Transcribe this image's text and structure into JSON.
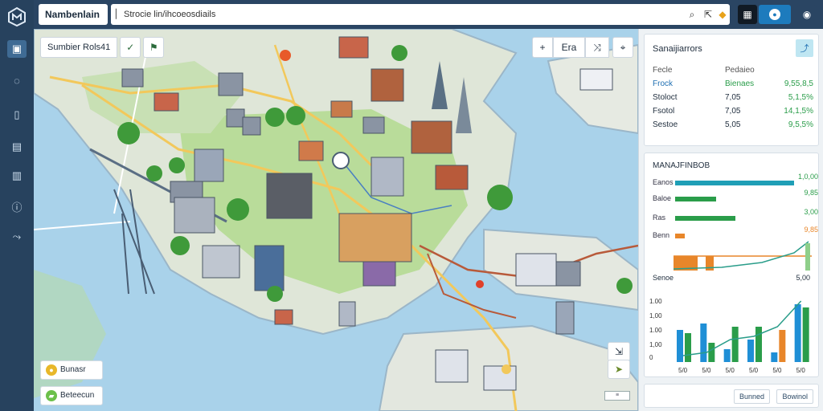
{
  "app": {
    "title": "Nambenlain"
  },
  "search": {
    "value": "Strocie lin/ihcoeosdiails"
  },
  "layer_bar": {
    "label": "Sumbier Rols41"
  },
  "map_controls": {
    "zoom_in": "+",
    "layers_label": "Era"
  },
  "legend": [
    {
      "label": "Bunasr",
      "color": "#e8b72a"
    },
    {
      "label": "Beteecun",
      "color": "#6cc04a"
    }
  ],
  "panel": {
    "summary": {
      "title": "Sanaijiarrors",
      "col1": "Fecle",
      "col2": "Pedaieo",
      "rows": [
        {
          "name": "Frock",
          "v1": "Bienaes",
          "v2": "9,55,8,5"
        },
        {
          "name": "Stoloct",
          "v1": "7,05",
          "v2": "5,1,5%"
        },
        {
          "name": "Fsotol",
          "v1": "7,05",
          "v2": "14,1,5%"
        },
        {
          "name": "Sestoe",
          "v1": "5,05",
          "v2": "9,5,5%"
        }
      ]
    },
    "metrics": {
      "title": "MANAJFINBOB",
      "rows": [
        {
          "name": "Eanos",
          "value": "1,0,00",
          "fraction": 0.95,
          "color": "#1f9fb6"
        },
        {
          "name": "Baloe",
          "value": "9,85",
          "fraction": 0.33,
          "color": "#2a9d4a"
        },
        {
          "name": "Ras",
          "value": "3,00",
          "fraction": 0.48,
          "color": "#2a9d4a"
        },
        {
          "name": "Benn",
          "value": "9,85",
          "fraction": 0.08,
          "color": "#e8862a"
        }
      ],
      "trend_label": "Senoe",
      "mini_end": "5,00",
      "bottom_chart": {
        "y_ticks": [
          "1.00",
          "1,00",
          "1.00",
          "1,00",
          "0"
        ],
        "x_ticks": [
          "5/0",
          "5/0",
          "5/0",
          "5/0",
          "5/0",
          "5/0"
        ]
      }
    },
    "footer": {
      "tab1": "Bunned",
      "tab2": "Bowinol"
    }
  },
  "chart_data": {
    "type": "bar",
    "categories": [
      "5/0",
      "5/0",
      "5/0",
      "5/0",
      "5/0",
      "5/0"
    ],
    "series": [
      {
        "values": [
          0.5,
          0.6,
          0.2,
          0.35,
          0.15,
          0.9
        ]
      },
      {
        "values": [
          0.45,
          0.3,
          0.55,
          0.55,
          0.5,
          0.85
        ]
      }
    ],
    "colors": [
      "#1f8fd6",
      "#2a9d4a",
      "#e8862a"
    ],
    "trend": [
      0.1,
      0.15,
      0.35,
      0.4,
      0.55,
      0.95
    ]
  }
}
